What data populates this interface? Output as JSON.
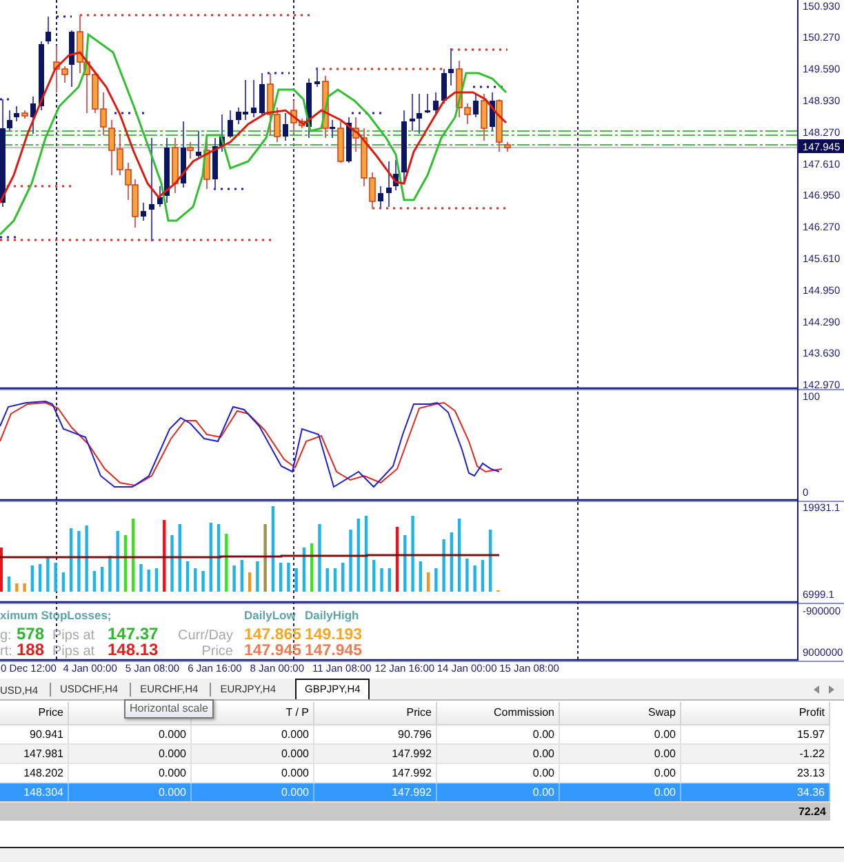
{
  "chart": {
    "price_axis": [
      "150.930",
      "150.270",
      "149.590",
      "148.930",
      "148.270",
      "147.610",
      "146.950",
      "146.270",
      "145.610",
      "144.950",
      "144.290",
      "143.630",
      "142.970"
    ],
    "current_price": "147.945",
    "stochastic_axis": [
      "100",
      "0"
    ],
    "volume_axis": [
      "19931.1",
      "6999.1"
    ],
    "info_axis": [
      "-900000",
      "9000000"
    ],
    "info_panel": {
      "title": "ximum StopLosses;",
      "stop_rows": [
        {
          "label": "g:",
          "pips": "578",
          "pips_label": "Pips at",
          "price": "147.37",
          "color": "#2db82d"
        },
        {
          "label": "rt:",
          "pips": "188",
          "pips_label": "Pips at",
          "price": "148.13",
          "color": "#e0201e"
        }
      ],
      "daily_headers": [
        "DailyLow",
        "DailyHigh"
      ],
      "daily_rows": [
        {
          "label": "Curr/Day",
          "low": "147.865",
          "high": "149.193",
          "color": "#f5a623"
        },
        {
          "label": "Price",
          "low": "147.945",
          "high": "147.945",
          "color": "#f07a50"
        }
      ]
    },
    "time_axis": [
      "0 Dec 12:00",
      "4 Jan 00:00",
      "5 Jan 08:00",
      "6 Jan 16:00",
      "8 Jan 00:00",
      "11 Jan 08:00",
      "12 Jan 16:00",
      "14 Jan 00:00",
      "15 Jan 08:00"
    ]
  },
  "tabs": [
    {
      "label": "USD,H4",
      "selected": false
    },
    {
      "label": "USDCHF,H4",
      "selected": false
    },
    {
      "label": "EURCHF,H4",
      "selected": false
    },
    {
      "label": "EURJPY,H4",
      "selected": false
    },
    {
      "label": "GBPJPY,H4",
      "selected": true
    }
  ],
  "tooltip": "Horizontal scale",
  "table": {
    "columns": [
      {
        "kind": "text",
        "label": "Price"
      },
      {
        "kind": "covered"
      },
      {
        "kind": "text",
        "label": "T / P"
      },
      {
        "kind": "text",
        "label": "Price"
      },
      {
        "kind": "text",
        "label": "Commission"
      },
      {
        "kind": "text",
        "label": "Swap"
      },
      {
        "kind": "text",
        "label": "Profit"
      }
    ],
    "rows": [
      {
        "cells": [
          "90.941",
          "0.000",
          "0.000",
          "90.796",
          "0.00",
          "0.00",
          "15.97"
        ],
        "selected": false
      },
      {
        "cells": [
          "147.981",
          "0.000",
          "0.000",
          "147.992",
          "0.00",
          "0.00",
          "-1.22"
        ],
        "selected": false
      },
      {
        "cells": [
          "148.202",
          "0.000",
          "0.000",
          "147.992",
          "0.00",
          "0.00",
          "23.13"
        ],
        "selected": false
      },
      {
        "cells": [
          "148.304",
          "0.000",
          "0.000",
          "147.992",
          "0.00",
          "0.00",
          "34.36"
        ],
        "selected": true
      }
    ],
    "total": "72.24"
  }
}
